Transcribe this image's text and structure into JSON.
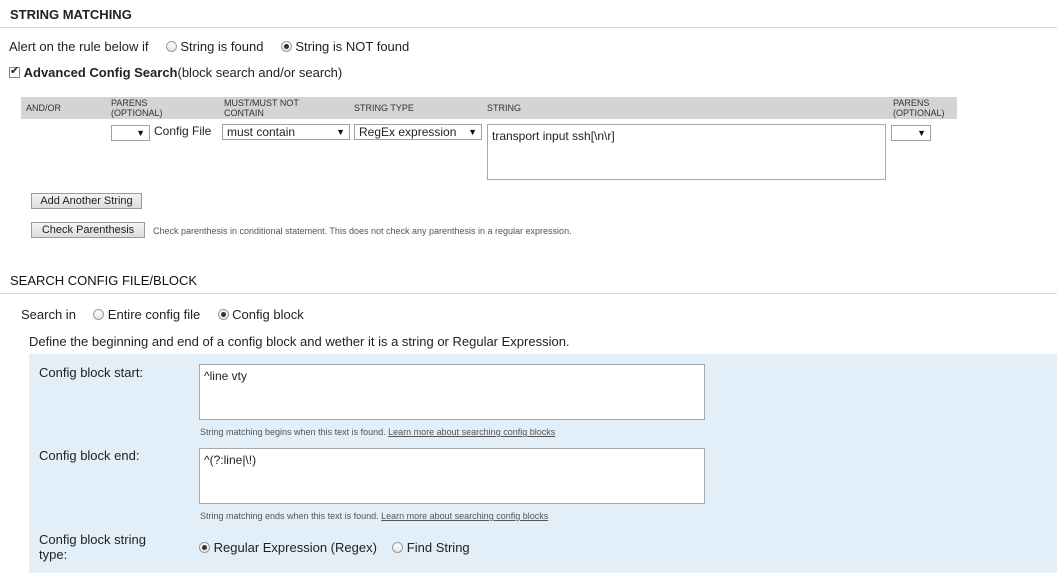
{
  "string_matching": {
    "title": "STRING MATCHING",
    "alert_label": "Alert on the rule below if",
    "option_found": "String is found",
    "option_not_found": "String is NOT found",
    "advanced_label": "Advanced Config Search",
    "advanced_suffix": "(block search and/or search)",
    "columns": {
      "and_or": "AND/OR",
      "parens_open_1": "PARENS",
      "parens_open_2": "(OPTIONAL)",
      "must_1": "MUST/MUST NOT",
      "must_2": "CONTAIN",
      "string_type": "STRING TYPE",
      "string": "STRING",
      "parens_close_1": "PARENS",
      "parens_close_2": "(OPTIONAL)"
    },
    "row": {
      "config_file_label": "Config File",
      "must_value": "must contain",
      "string_type_value": "RegEx expression",
      "string_value": "transport input ssh[\\n\\r]"
    },
    "add_button": "Add Another String",
    "check_button": "Check Parenthesis",
    "check_hint": "Check parenthesis in conditional statement. This does not check any parenthesis in a regular expression."
  },
  "search_config": {
    "title": "SEARCH CONFIG FILE/BLOCK",
    "search_in_label": "Search in",
    "option_entire": "Entire config file",
    "option_block": "Config block",
    "define_text": "Define the beginning and end of a config block and wether it is a string or Regular Expression.",
    "block_start_label": "Config block start:",
    "block_start_value": "^line vty",
    "block_start_hint": "String matching begins when this text is found.",
    "block_end_label": "Config block end:",
    "block_end_value": "^(?:line|\\!)",
    "block_end_hint": "String matching ends when this text is found.",
    "learn_more": "Learn more about searching config blocks",
    "type_label_1": "Config block string",
    "type_label_2": "type:",
    "option_regex": "Regular Expression (Regex)",
    "option_find": "Find String"
  }
}
